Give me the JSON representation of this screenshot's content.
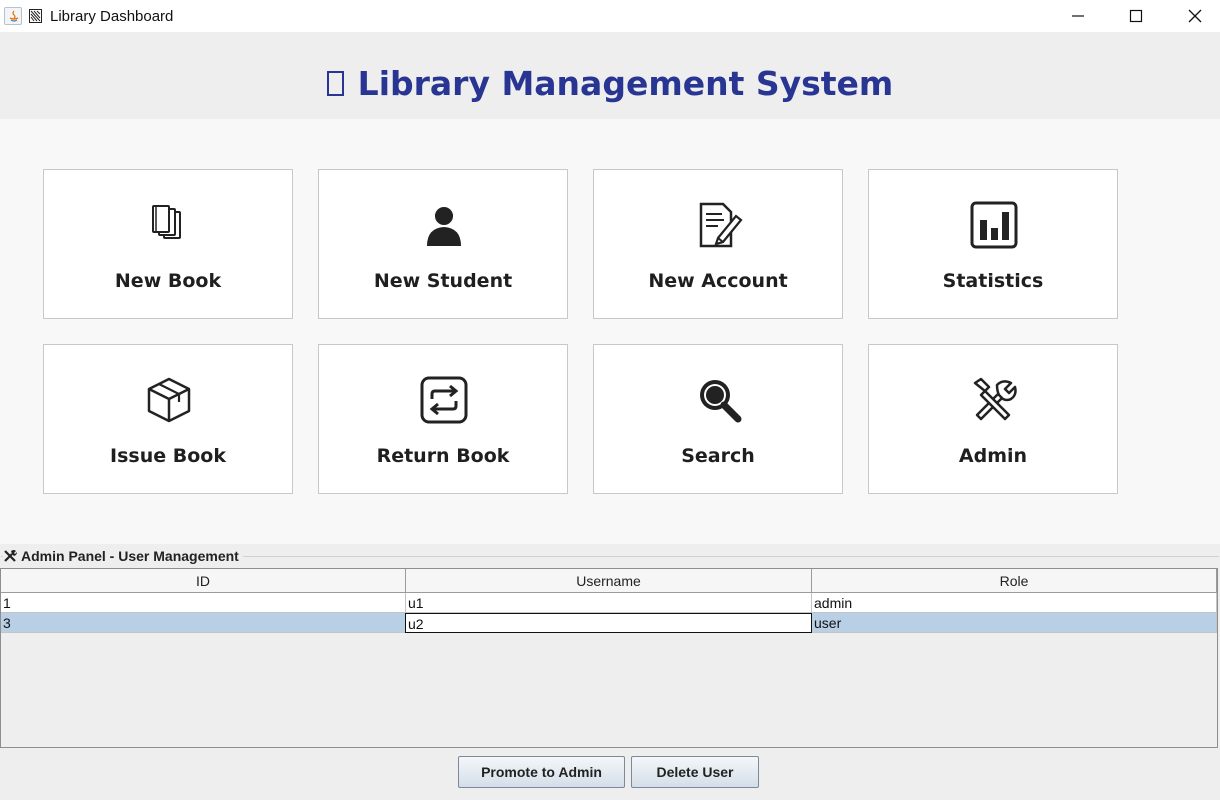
{
  "window": {
    "title": "Library Dashboard",
    "controls": [
      "minimize",
      "maximize",
      "close"
    ]
  },
  "header": {
    "title": "Library Management System",
    "title_color": "#283593"
  },
  "tiles": [
    {
      "label": "New Book",
      "icon": "books-icon"
    },
    {
      "label": "New Student",
      "icon": "student-icon"
    },
    {
      "label": "New Account",
      "icon": "edit-document-icon"
    },
    {
      "label": "Statistics",
      "icon": "bar-chart-icon"
    },
    {
      "label": "Issue Book",
      "icon": "package-icon"
    },
    {
      "label": "Return Book",
      "icon": "repeat-icon"
    },
    {
      "label": "Search",
      "icon": "magnifier-icon"
    },
    {
      "label": "Admin",
      "icon": "tools-icon"
    }
  ],
  "admin_panel": {
    "title": "Admin Panel - User Management",
    "columns": [
      "ID",
      "Username",
      "Role"
    ],
    "rows": [
      {
        "id": "1",
        "username": "u1",
        "role": "admin",
        "selected": false
      },
      {
        "id": "3",
        "username": "u2",
        "role": "user",
        "selected": true
      }
    ],
    "buttons": {
      "promote": "Promote to Admin",
      "delete": "Delete User"
    },
    "selection_color": "#b8cfe5"
  }
}
